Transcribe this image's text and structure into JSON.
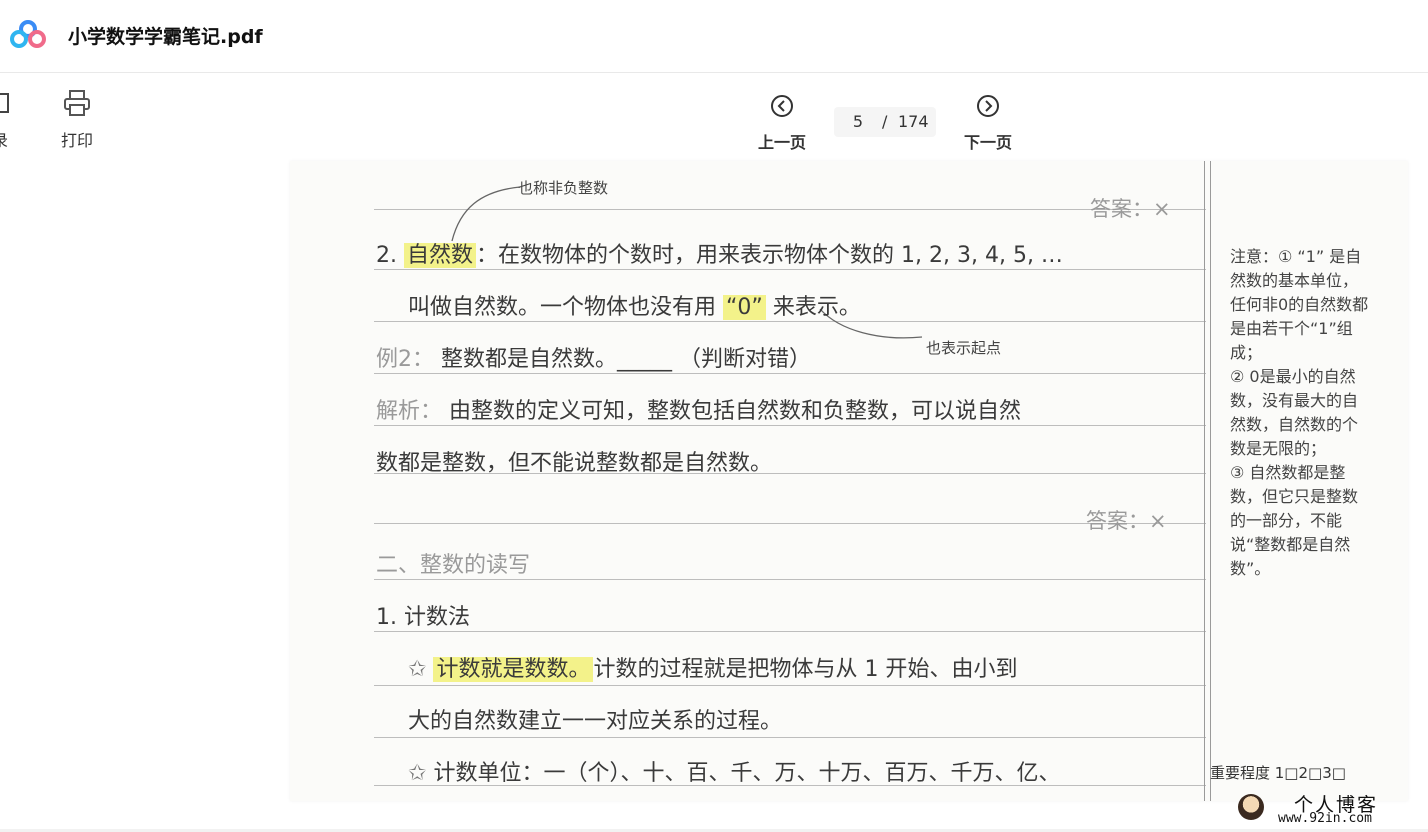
{
  "app": {
    "title": "小学数学学霸笔记.pdf"
  },
  "toolbar": {
    "catalog_label": "录",
    "print_label": "打印",
    "prev_label": "上一页",
    "next_label": "下一页",
    "page_current": "5",
    "page_separator": "/",
    "page_total": "174"
  },
  "doc": {
    "top_note": "也称非负整数",
    "answer_1": "答案：×",
    "line_2_num": "2.",
    "line_2_term": "自然数",
    "line_2_rest": "：在数物体的个数时，用来表示物体个数的 1, 2, 3, 4, 5, …",
    "line_3_pre": "叫做自然数。一个物体也没有用",
    "line_3_zero": "“0”",
    "line_3_post": "来表示。",
    "zero_note": "也表示起点",
    "example_label": "例2：",
    "example_text": "整数都是自然数。_____ （判断对错）",
    "analysis_label": "解析：",
    "analysis_text": "由整数的定义可知，整数包括自然数和负整数，可以说自然",
    "analysis_text_2": "数都是整数，但不能说整数都是自然数。",
    "answer_2": "答案：×",
    "section_2": "二、整数的读写",
    "sub_1": "1. 计数法",
    "counting_hl": "计数就是数数。",
    "counting_rest": "计数的过程就是把物体与从 1 开始、由小到",
    "counting_rest_2": "大的自然数建立一一对应关系的过程。",
    "unit_line": "计数单位：一（个）、十、百、千、万、十万、百万、千万、亿、",
    "side_notes": [
      "注意：① “1” 是自然数的基本单位，任何非0的自然数都是由若干个“1”组成；",
      "② 0是最小的自然数，没有最大的自然数，自然数的个数是无限的；",
      "③ 自然数都是整数，但它只是整数的一部分，不能说“整数都是自然数”。"
    ],
    "importance": "重要程度 1□2□3□"
  },
  "watermark": {
    "title": "个人博客",
    "url": "www.92in.com"
  },
  "colors": {
    "highlight": "#f3f28a",
    "logo_blue": "#3a8cf5",
    "logo_pink": "#f06b8a"
  }
}
